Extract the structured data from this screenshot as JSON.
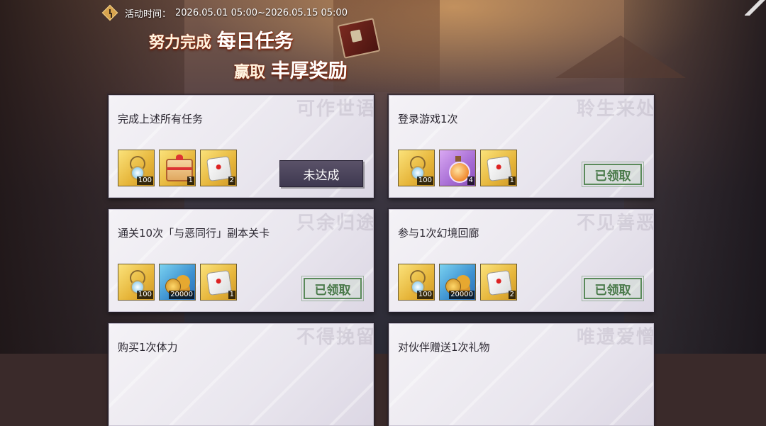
{
  "event": {
    "time_label": "活动时间：",
    "time_value": "2026.05.01 05:00~2026.05.15 05:00"
  },
  "banner": {
    "line1_prefix": "努力完成",
    "line1_em": "每日任务",
    "line2_prefix": "赢取",
    "line2_em": "丰厚奖励"
  },
  "tasks": [
    {
      "title": "完成上述所有任务",
      "watermark": "可作世语",
      "rewards": [
        {
          "icon": "pendant-icon",
          "count": "100",
          "color": "gold"
        },
        {
          "icon": "gift-box-icon",
          "count": "1",
          "color": "gold"
        },
        {
          "icon": "dice-icon",
          "count": "2",
          "color": "gold"
        }
      ],
      "status": "未达成"
    },
    {
      "title": "登录游戏1次",
      "watermark": "聆生来处",
      "rewards": [
        {
          "icon": "pendant-icon",
          "count": "100",
          "color": "gold"
        },
        {
          "icon": "potion-icon",
          "count": "4",
          "color": "purple"
        },
        {
          "icon": "dice-icon",
          "count": "1",
          "color": "gold"
        }
      ],
      "status": "已领取"
    },
    {
      "title": "通关10次「与恶同行」副本关卡",
      "watermark": "只余归途",
      "rewards": [
        {
          "icon": "pendant-icon",
          "count": "100",
          "color": "gold"
        },
        {
          "icon": "coins-icon",
          "count": "20000",
          "color": "blue"
        },
        {
          "icon": "dice-icon",
          "count": "1",
          "color": "gold"
        }
      ],
      "status": "已领取"
    },
    {
      "title": "参与1次幻境回廊",
      "watermark": "不见善恶",
      "rewards": [
        {
          "icon": "pendant-icon",
          "count": "100",
          "color": "gold"
        },
        {
          "icon": "coins-icon",
          "count": "20000",
          "color": "blue"
        },
        {
          "icon": "dice-icon",
          "count": "2",
          "color": "gold"
        }
      ],
      "status": "已领取"
    },
    {
      "title": "购买1次体力",
      "watermark": "不得挽留",
      "rewards": [],
      "status": ""
    },
    {
      "title": "对伙伴赠送1次礼物",
      "watermark": "唯遗爱憎",
      "rewards": [],
      "status": ""
    }
  ]
}
